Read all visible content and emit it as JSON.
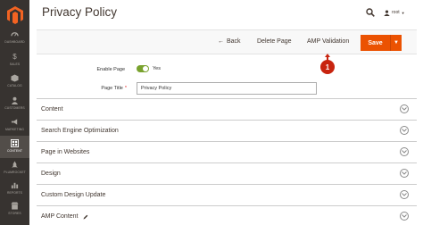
{
  "page": {
    "title": "Privacy Policy"
  },
  "header": {
    "user_name": "root"
  },
  "sidebar": {
    "items": [
      {
        "label": "DASHBOARD",
        "icon": "dashboard-icon"
      },
      {
        "label": "SALES",
        "icon": "dollar-icon"
      },
      {
        "label": "CATALOG",
        "icon": "cube-icon"
      },
      {
        "label": "CUSTOMERS",
        "icon": "person-icon"
      },
      {
        "label": "MARKETING",
        "icon": "megaphone-icon"
      },
      {
        "label": "CONTENT",
        "icon": "content-grid-icon",
        "active": true
      },
      {
        "label": "PLUMROCKET",
        "icon": "plumrocket-icon"
      },
      {
        "label": "REPORTS",
        "icon": "bar-chart-icon"
      },
      {
        "label": "STORES",
        "icon": "store-icon"
      }
    ]
  },
  "toolbar": {
    "back_label": "Back",
    "delete_label": "Delete Page",
    "amp_label": "AMP Validation",
    "save_label": "Save"
  },
  "callout": {
    "number": "1"
  },
  "form": {
    "enable_label": "Enable Page",
    "enable_value": "Yes",
    "title_label": "Page Title",
    "title_required": "*",
    "title_value": "Privacy Policy"
  },
  "sections": [
    {
      "title": "Content"
    },
    {
      "title": "Search Engine Optimization"
    },
    {
      "title": "Page in Websites"
    },
    {
      "title": "Design"
    },
    {
      "title": "Custom Design Update"
    },
    {
      "title": "AMP Content"
    }
  ],
  "colors": {
    "sidebar_bg": "#373330",
    "sidebar_active": "#524d49",
    "primary_button": "#eb5202",
    "toggle_on": "#79a22e",
    "callout": "#c8240f"
  }
}
